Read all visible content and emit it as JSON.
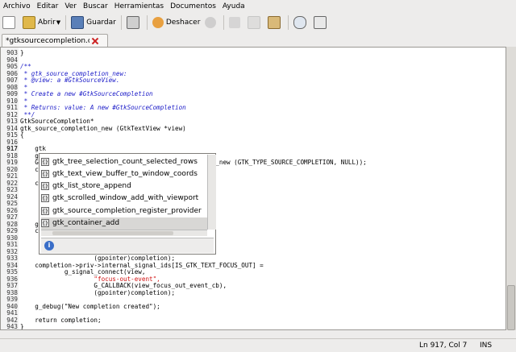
{
  "menubar": {
    "items": [
      "Archivo",
      "Editar",
      "Ver",
      "Buscar",
      "Herramientas",
      "Documentos",
      "Ayuda"
    ]
  },
  "toolbar": {
    "new_icon": "new-document-icon",
    "open_label": "Abrir",
    "save_label": "Guardar",
    "undo_label": "Deshacer"
  },
  "tab": {
    "title": "*gtksourcecompletion.c"
  },
  "editor": {
    "lines": [
      {
        "n": "903",
        "t": "}"
      },
      {
        "n": "904",
        "t": ""
      },
      {
        "n": "905",
        "t": "/**",
        "c": "cm"
      },
      {
        "n": "906",
        "t": " * gtk_source_completion_new:",
        "c": "cm"
      },
      {
        "n": "907",
        "t": " * @view: a #GtkSourceView.",
        "c": "cm"
      },
      {
        "n": "908",
        "t": " *",
        "c": "cm"
      },
      {
        "n": "909",
        "t": " * Create a new #GtkSourceCompletion",
        "c": "cm"
      },
      {
        "n": "910",
        "t": " *",
        "c": "cm"
      },
      {
        "n": "911",
        "t": " * Returns: value: A new #GtkSourceCompletion",
        "c": "cm"
      },
      {
        "n": "912",
        "t": " **/",
        "c": "cm"
      },
      {
        "n": "913",
        "t": "GtkSourceCompletion*"
      },
      {
        "n": "914",
        "t": "gtk_source_completion_new (GtkTextView *view)"
      },
      {
        "n": "915",
        "t": "{"
      },
      {
        "n": "916",
        "t": ""
      },
      {
        "n": "917",
        "t": "    gtk"
      },
      {
        "n": "918",
        "t": "    g_d"
      },
      {
        "n": "919",
        "t": "    Gtk                                  ON (g_object_new (GTK_TYPE_SOURCE_COMPLETION, NULL));"
      },
      {
        "n": "920",
        "t": "    com"
      },
      {
        "n": "921",
        "t": ""
      },
      {
        "n": "922",
        "t": "    com                                  W_KP] ="
      },
      {
        "n": "923",
        "t": ""
      },
      {
        "n": "924",
        "t": ""
      },
      {
        "n": "925",
        "t": ""
      },
      {
        "n": "926",
        "t": ""
      },
      {
        "n": "927",
        "t": ""
      },
      {
        "n": "928",
        "t": "    g_d"
      },
      {
        "n": "929",
        "t": "    com                                  TROY] ="
      },
      {
        "n": "930",
        "t": ""
      },
      {
        "n": "931",
        "t": ""
      },
      {
        "n": "932",
        "t": ""
      },
      {
        "n": "933",
        "t": "                    (gpointer)completion);"
      },
      {
        "n": "934",
        "t": "    completion->priv->internal_signal_ids[IS_GTK_TEXT_FOCUS_OUT] ="
      },
      {
        "n": "935",
        "t": "            g_signal_connect(view,"
      },
      {
        "n": "936",
        "t": "                    \"focus-out-event\",",
        "c": "str"
      },
      {
        "n": "937",
        "t": "                    G_CALLBACK(view_focus_out_event_cb),"
      },
      {
        "n": "938",
        "t": "                    (gpointer)completion);"
      },
      {
        "n": "939",
        "t": ""
      },
      {
        "n": "940",
        "t": "    g_debug(\"New completion created\");"
      },
      {
        "n": "941",
        "t": ""
      },
      {
        "n": "942",
        "t": "    return completion;"
      },
      {
        "n": "943",
        "t": "}"
      }
    ]
  },
  "completion": {
    "items": [
      "gtk_tree_selection_count_selected_rows",
      "gtk_text_view_buffer_to_window_coords",
      "gtk_list_store_append",
      "gtk_scrolled_window_add_with_viewport",
      "gtk_source_completion_register_provider",
      "gtk_container_add"
    ],
    "selected_index": 5,
    "info_icon": "info-icon"
  },
  "statusbar": {
    "position": "Ln 917, Col 7",
    "mode": "INS"
  }
}
